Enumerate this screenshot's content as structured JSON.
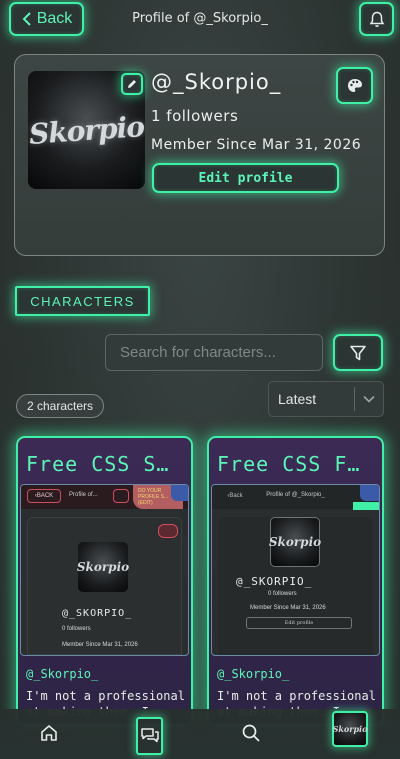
{
  "header": {
    "back_label": "Back",
    "title": "Profile of @_Skorpio_"
  },
  "profile": {
    "avatar_text": "Skorpio",
    "username": "@_Skorpio_",
    "followers": "1 followers",
    "member_since": "Member Since Mar 31, 2026",
    "edit_profile_label": "Edit profile"
  },
  "tabs": {
    "characters_label": "CHARACTERS"
  },
  "search": {
    "placeholder": "Search for characters..."
  },
  "list": {
    "count_label": "2 characters",
    "sort_value": "Latest"
  },
  "characters": [
    {
      "title": "Free CSS S…",
      "author": "@_Skorpio_",
      "description": "I'm not a professional at making them. I don't",
      "preview": {
        "back": "BACK",
        "title": "Profile of...",
        "badge": "DO YOUR PROFILE S... (EDIT)",
        "avatar_text": "Skorpio",
        "user": "@_SKORPIO_",
        "followers": "0 followers",
        "member_since": "Member Since Mar 31, 2026"
      }
    },
    {
      "title": "Free CSS F…",
      "author": "@_Skorpio_",
      "description": "I'm not a professional at making them. I don't",
      "preview": {
        "back": "Back",
        "title": "Profile of @_Skorpio_",
        "avatar_text": "Skorpio",
        "user": "@_SKORPIO_",
        "followers": "0 followers",
        "member_since": "Member Since Mar 31, 2026",
        "edit_label": "Edit profile"
      }
    }
  ],
  "nav": {
    "profile_avatar_text": "Skorpio"
  },
  "colors": {
    "accent": "#3ff0a6",
    "background": "#2c3432",
    "card_purple": "#3c2a55"
  }
}
